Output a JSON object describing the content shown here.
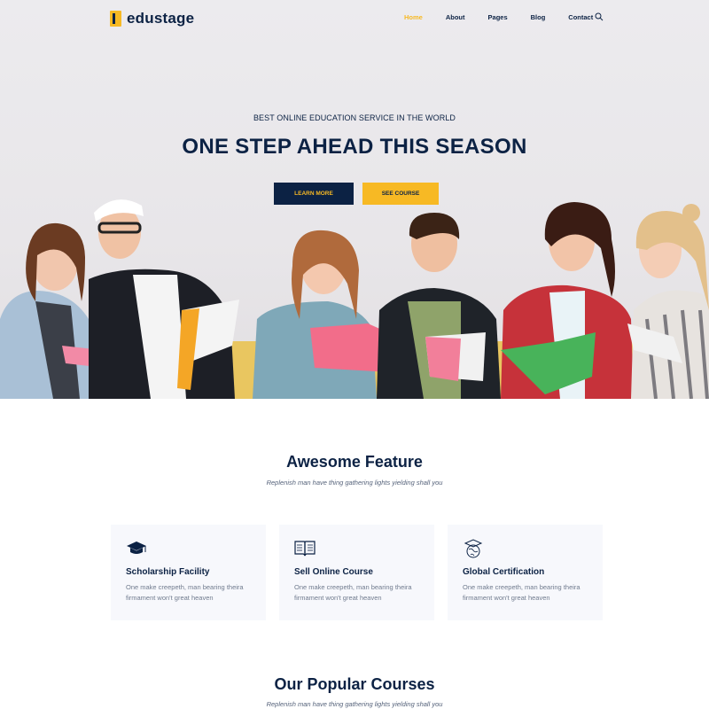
{
  "brand": {
    "name": "edustage"
  },
  "nav": {
    "items": [
      {
        "label": "Home",
        "active": true
      },
      {
        "label": "About",
        "active": false
      },
      {
        "label": "Pages",
        "active": false
      },
      {
        "label": "Blog",
        "active": false
      },
      {
        "label": "Contact",
        "active": false
      }
    ],
    "search_icon": "search-icon"
  },
  "hero": {
    "subtitle": "BEST ONLINE EDUCATION SERVICE IN THE WORLD",
    "title": "ONE STEP AHEAD THIS SEASON",
    "primary_button": "LEARN MORE",
    "secondary_button": "SEE COURSE"
  },
  "features": {
    "title": "Awesome Feature",
    "subtitle": "Replenish man have thing gathering lights yielding shall you",
    "cards": [
      {
        "icon": "graduation-cap-icon",
        "title": "Scholarship Facility",
        "description": "One make creepeth, man bearing theira firmament won't great heaven"
      },
      {
        "icon": "open-book-icon",
        "title": "Sell Online Course",
        "description": "One make creepeth, man bearing theira firmament won't great heaven"
      },
      {
        "icon": "globe-graduate-icon",
        "title": "Global Certification",
        "description": "One make creepeth, man bearing theira firmament won't great heaven"
      }
    ]
  },
  "courses": {
    "title": "Our Popular Courses",
    "subtitle": "Replenish man have thing gathering lights yielding shall you"
  },
  "colors": {
    "navy": "#0c2244",
    "accent": "#f7b924",
    "card_bg": "#f7f8fc"
  }
}
